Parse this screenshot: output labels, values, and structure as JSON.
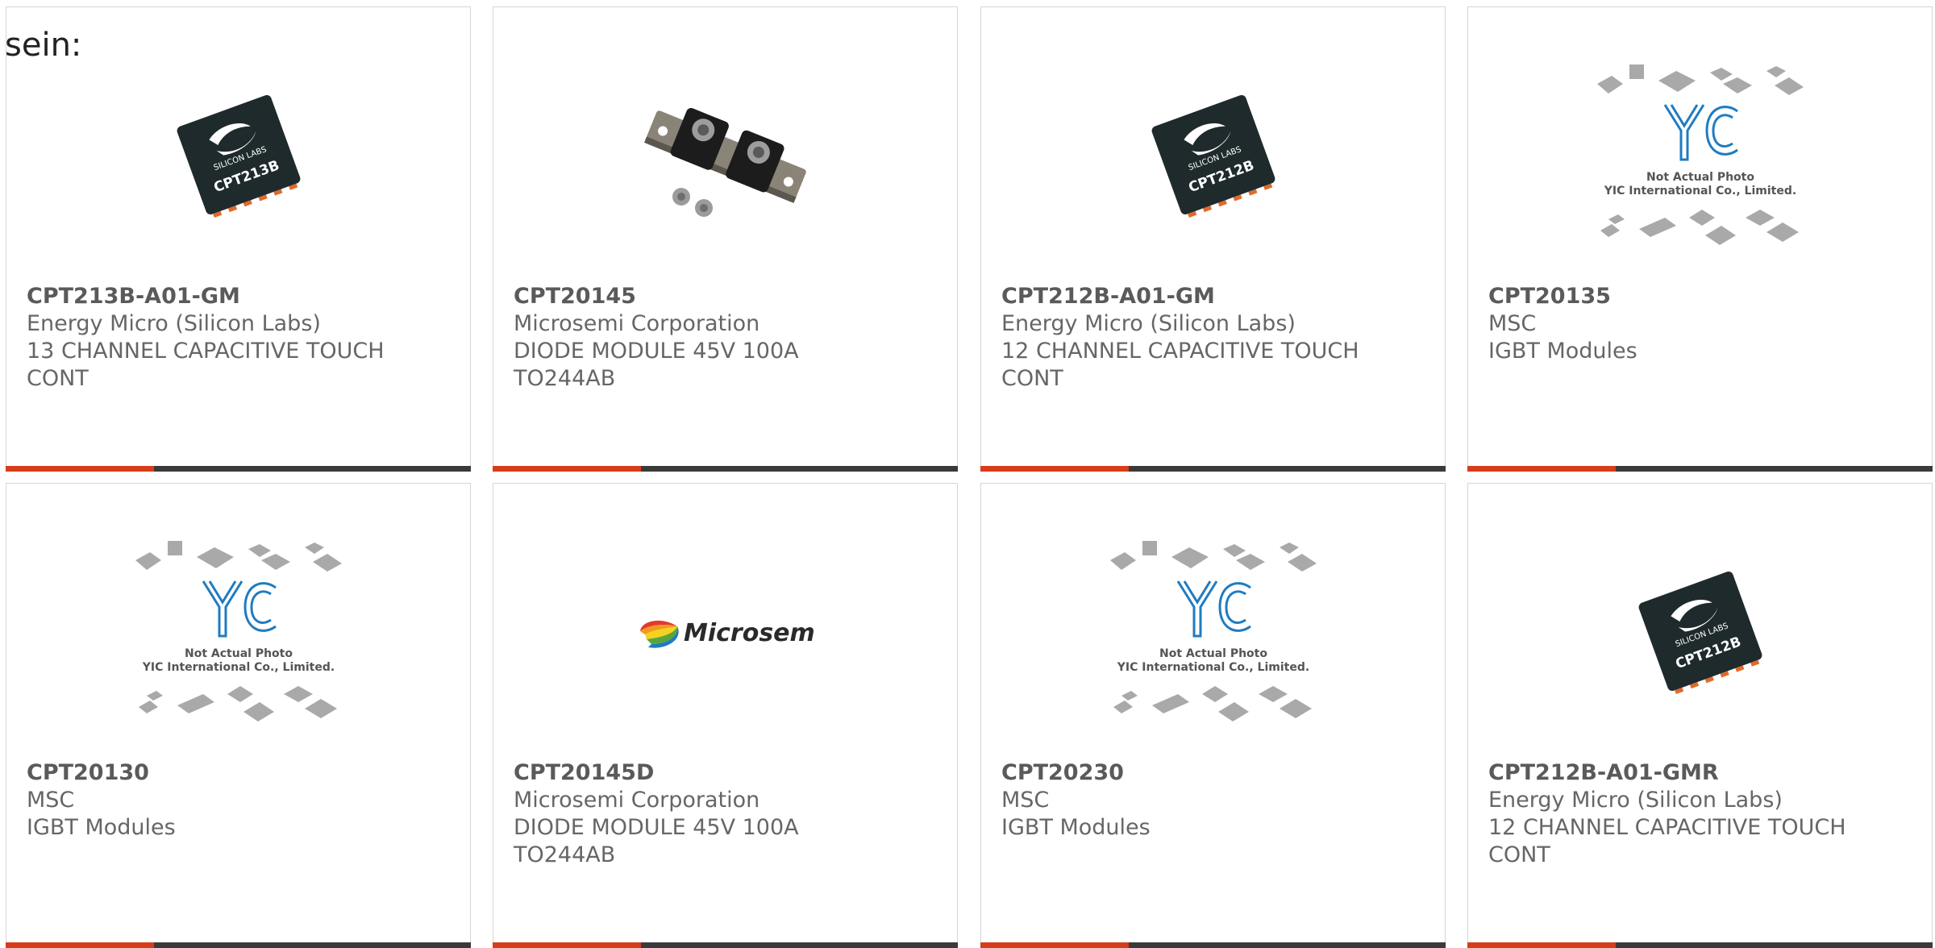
{
  "intro": "sein:",
  "colors": {
    "accent": "#d63d1a",
    "bar": "#3a3a3a",
    "border": "#d6d6d6",
    "text": "#666666",
    "chip": "#1f2a2c",
    "yic_blue": "#1f7bc1"
  },
  "placeholder": {
    "brand": "YIC",
    "line1": "Not Actual Photo",
    "line2": "YIC International Co., Limited."
  },
  "chips": {
    "brand": "SILICON LABS",
    "m213": "CPT213B",
    "m212": "CPT212B"
  },
  "microsemi_logo": "Microsemi",
  "products": [
    {
      "part": "CPT213B-A01-GM",
      "maker": "Energy Micro (Silicon Labs)",
      "desc1": "13 CHANNEL CAPACITIVE TOUCH",
      "desc2": "CONT",
      "image": "chip-cpt213b-icon"
    },
    {
      "part": "CPT20145",
      "maker": "Microsemi Corporation",
      "desc1": "DIODE MODULE 45V 100A",
      "desc2": "TO244AB",
      "image": "diode-module-icon"
    },
    {
      "part": "CPT212B-A01-GM",
      "maker": "Energy Micro (Silicon Labs)",
      "desc1": "12 CHANNEL CAPACITIVE TOUCH",
      "desc2": "CONT",
      "image": "chip-cpt212b-icon"
    },
    {
      "part": "CPT20135",
      "maker": "MSC",
      "desc1": "IGBT Modules",
      "desc2": "",
      "image": "yic-placeholder-icon"
    },
    {
      "part": "CPT20130",
      "maker": "MSC",
      "desc1": "IGBT Modules",
      "desc2": "",
      "image": "yic-placeholder-icon"
    },
    {
      "part": "CPT20145D",
      "maker": "Microsemi Corporation",
      "desc1": "DIODE MODULE 45V 100A",
      "desc2": "TO244AB",
      "image": "microsemi-logo-icon"
    },
    {
      "part": "CPT20230",
      "maker": "MSC",
      "desc1": "IGBT Modules",
      "desc2": "",
      "image": "yic-placeholder-icon"
    },
    {
      "part": "CPT212B-A01-GMR",
      "maker": "Energy Micro (Silicon Labs)",
      "desc1": "12 CHANNEL CAPACITIVE TOUCH",
      "desc2": "CONT",
      "image": "chip-cpt212b-icon"
    }
  ]
}
